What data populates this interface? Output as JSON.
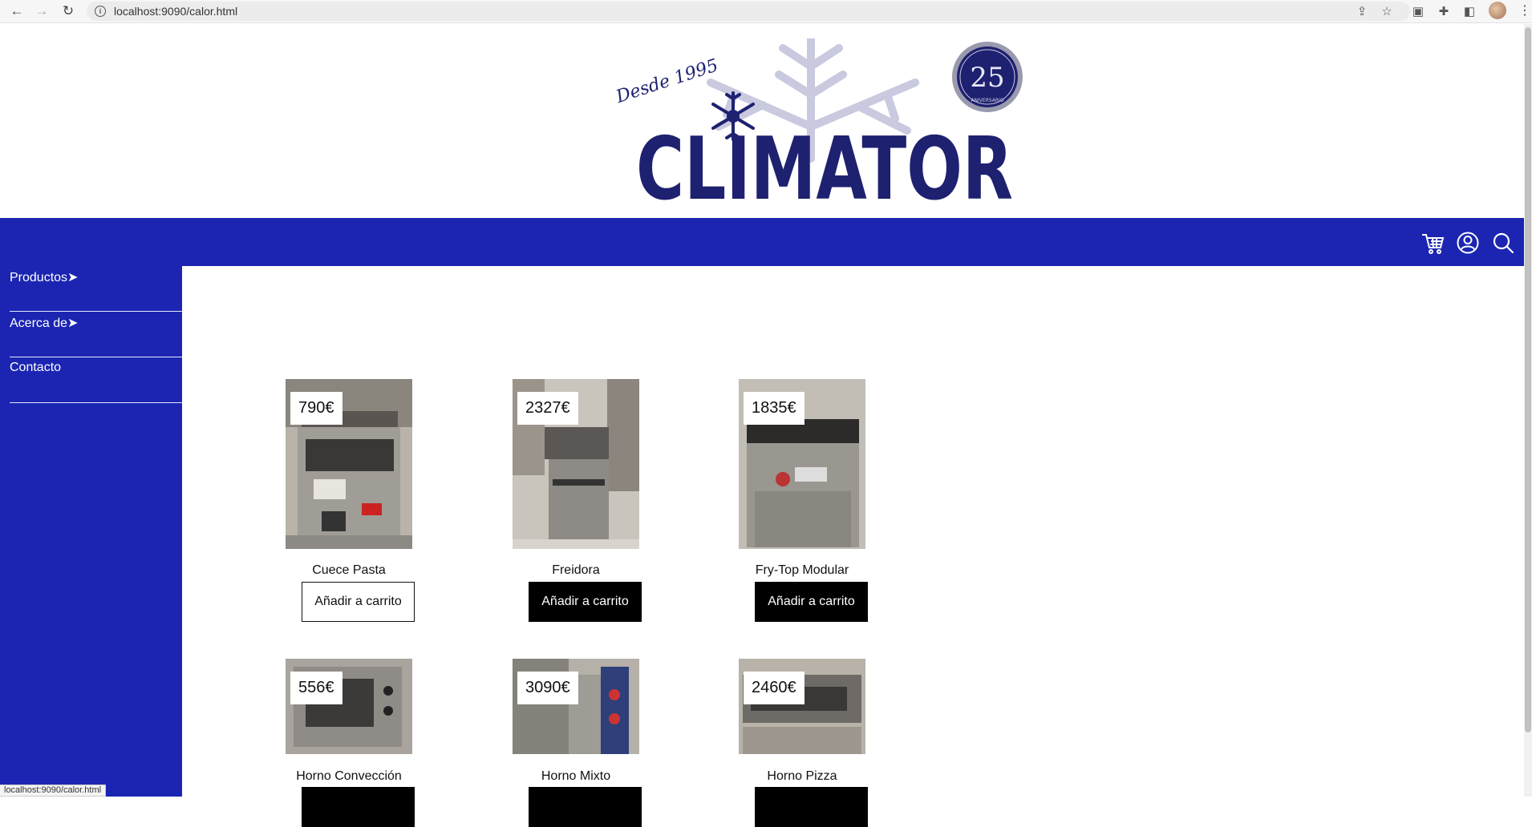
{
  "browser": {
    "url": "localhost:9090/calor.html",
    "status_text": "localhost:9090/calor.html"
  },
  "brand": {
    "name": "CLIMATOR",
    "tagline": "Desde 1995",
    "anniversary_number": "25",
    "anniversary_word": "ANIVERSARIO",
    "primary_color": "#1b25b2",
    "logo_color": "#1e2170",
    "flake_color": "#c9c9df"
  },
  "topbar": {
    "icons": [
      "cart-icon",
      "user-icon",
      "search-icon"
    ]
  },
  "sidebar": {
    "items": [
      {
        "label": "Productos➤"
      },
      {
        "label": "Acerca de➤"
      },
      {
        "label": "Contacto"
      }
    ]
  },
  "products": [
    {
      "name": "Cuece Pasta",
      "price": "790€",
      "button": "Añadir a carrito",
      "button_style": "outline"
    },
    {
      "name": "Freidora",
      "price": "2327€",
      "button": "Añadir a carrito",
      "button_style": "filled"
    },
    {
      "name": "Fry-Top Modular",
      "price": "1835€",
      "button": "Añadir a carrito",
      "button_style": "filled"
    },
    {
      "name": "Horno Convección",
      "price": "556€",
      "button": "",
      "button_style": "filled"
    },
    {
      "name": "Horno Mixto",
      "price": "3090€",
      "button": "",
      "button_style": "filled"
    },
    {
      "name": "Horno Pizza",
      "price": "2460€",
      "button": "",
      "button_style": "filled"
    }
  ]
}
